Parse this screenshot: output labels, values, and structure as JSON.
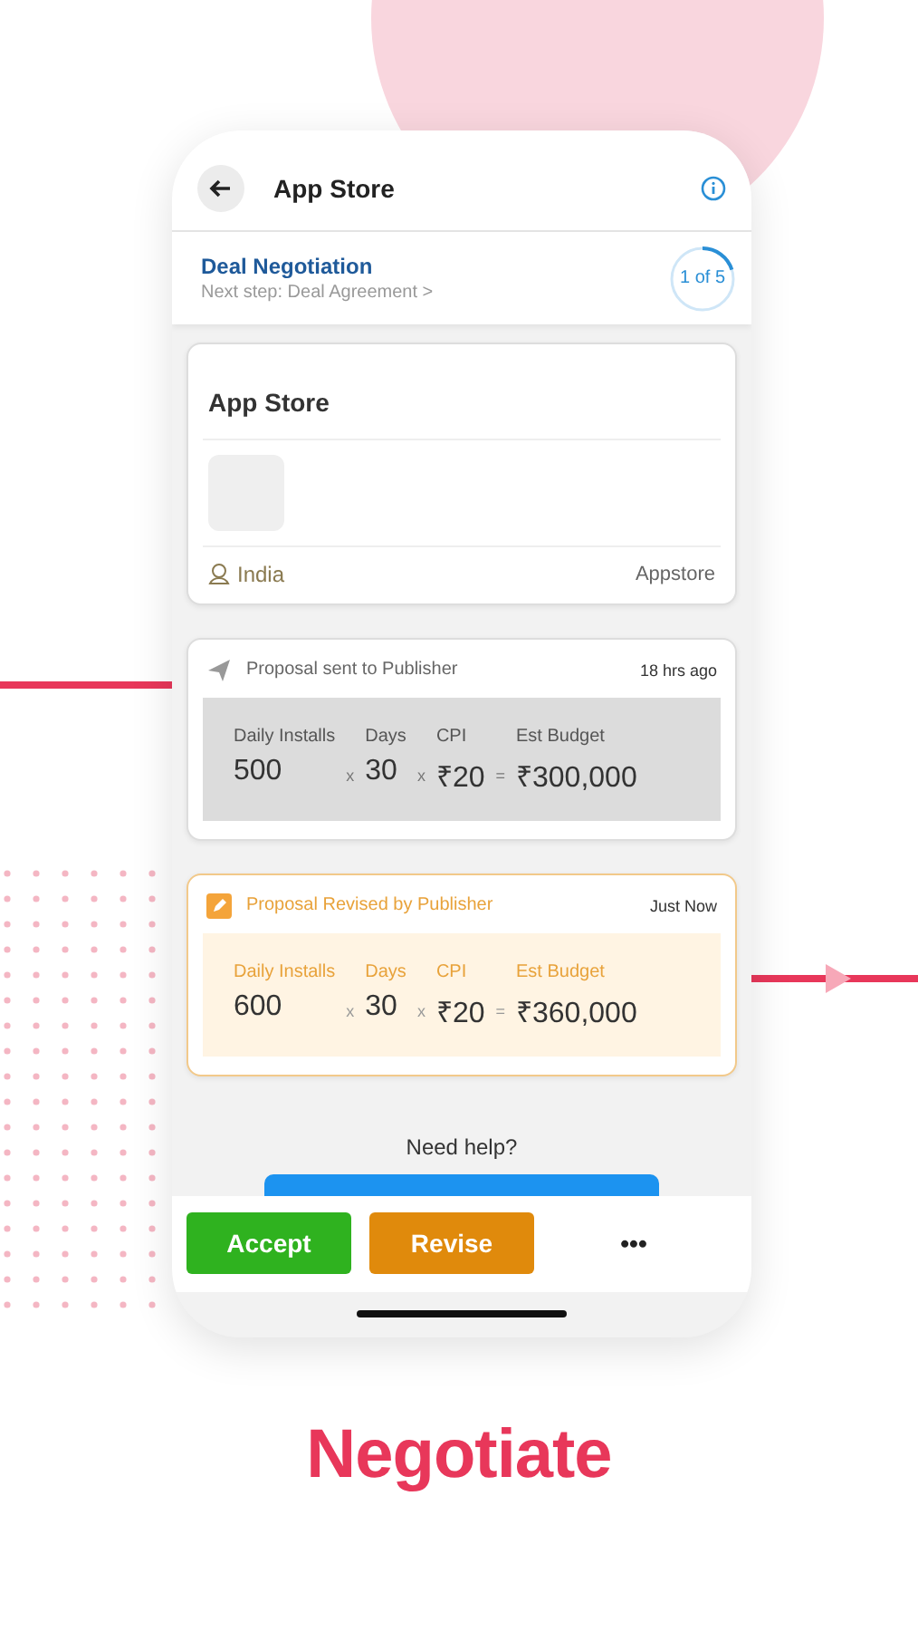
{
  "header": {
    "title": "App Store"
  },
  "step": {
    "title": "Deal Negotiation",
    "next": "Next step: Deal Agreement >",
    "counter": "1 of 5",
    "level": 0.2
  },
  "app_card": {
    "title": "App Store",
    "location": "India",
    "store": "Appstore"
  },
  "proposals": [
    {
      "kind": "sent",
      "title": "Proposal sent to Publisher",
      "time": "18 hrs ago",
      "stats": [
        {
          "label": "Daily Installs",
          "value": "500",
          "op": "x"
        },
        {
          "label": "Days",
          "value": "30",
          "op": "x"
        },
        {
          "label": "CPI",
          "value": "₹20",
          "op": "="
        },
        {
          "label": "Est Budget",
          "value": "₹300,000"
        }
      ]
    },
    {
      "kind": "revised",
      "title": "Proposal Revised by Publisher",
      "time": "Just Now",
      "stats": [
        {
          "label": "Daily Installs",
          "value": "600",
          "op": "x"
        },
        {
          "label": "Days",
          "value": "30",
          "op": "x"
        },
        {
          "label": "CPI",
          "value": "₹20",
          "op": "="
        },
        {
          "label": "Est Budget",
          "value": "₹360,000"
        }
      ]
    }
  ],
  "help": {
    "label": "Need help?"
  },
  "actions": [
    {
      "kind": "accept",
      "label": "Accept"
    },
    {
      "kind": "revise",
      "label": "Revise"
    },
    {
      "kind": "more",
      "label": "•••"
    }
  ],
  "headline": "Negotiate"
}
